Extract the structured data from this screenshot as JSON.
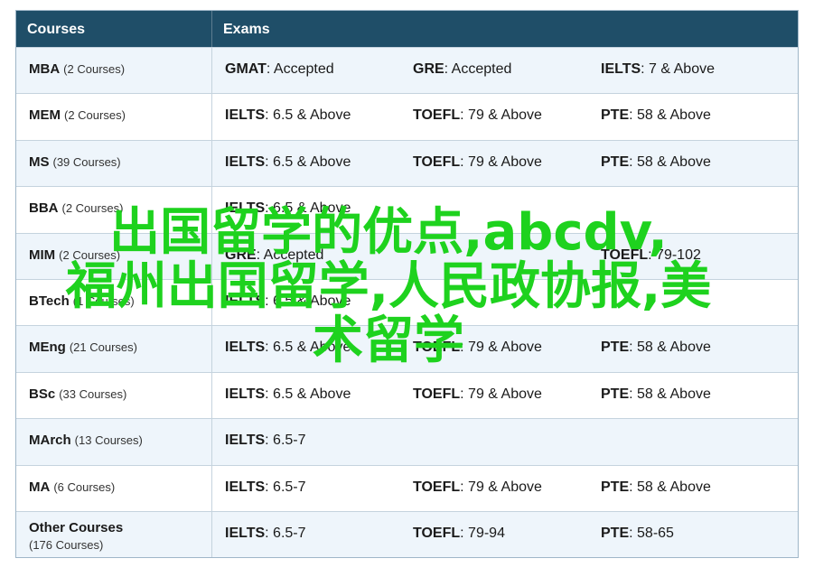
{
  "header": {
    "courses": "Courses",
    "exams": "Exams"
  },
  "rows": [
    {
      "name": "MBA",
      "count": "(2 Courses)",
      "exams": [
        {
          "k": "GMAT",
          "v": ": Accepted"
        },
        {
          "k": "GRE",
          "v": ": Accepted"
        },
        {
          "k": "IELTS",
          "v": ": 7 & Above"
        }
      ]
    },
    {
      "name": "MEM",
      "count": "(2 Courses)",
      "exams": [
        {
          "k": "IELTS",
          "v": ": 6.5 & Above"
        },
        {
          "k": "TOEFL",
          "v": ": 79 & Above"
        },
        {
          "k": "PTE",
          "v": ": 58 & Above"
        }
      ]
    },
    {
      "name": "MS",
      "count": "(39 Courses)",
      "exams": [
        {
          "k": "IELTS",
          "v": ": 6.5 & Above"
        },
        {
          "k": "TOEFL",
          "v": ": 79 & Above"
        },
        {
          "k": "PTE",
          "v": ": 58 & Above"
        }
      ]
    },
    {
      "name": "BBA",
      "count": "(2 Courses)",
      "exams": [
        {
          "k": "IELTS",
          "v": ": 6.5 & Above"
        },
        {
          "k": "",
          "v": ""
        },
        {
          "k": "",
          "v": ""
        }
      ]
    },
    {
      "name": "MIM",
      "count": "(2 Courses)",
      "exams": [
        {
          "k": "GRE",
          "v": ": Accepted"
        },
        {
          "k": "",
          "v": ""
        },
        {
          "k": "TOEFL",
          "v": ": 79-102"
        }
      ]
    },
    {
      "name": "BTech",
      "count": "(1 Courses)",
      "exams": [
        {
          "k": "IELTS",
          "v": ": 6.5 & Above"
        },
        {
          "k": "",
          "v": ""
        },
        {
          "k": "",
          "v": ""
        }
      ]
    },
    {
      "name": "MEng",
      "count": "(21 Courses)",
      "exams": [
        {
          "k": "IELTS",
          "v": ": 6.5 & Above"
        },
        {
          "k": "TOEFL",
          "v": ": 79 & Above"
        },
        {
          "k": "PTE",
          "v": ": 58 & Above"
        }
      ]
    },
    {
      "name": "BSc",
      "count": "(33 Courses)",
      "exams": [
        {
          "k": "IELTS",
          "v": ": 6.5 & Above"
        },
        {
          "k": "TOEFL",
          "v": ": 79 & Above"
        },
        {
          "k": "PTE",
          "v": ": 58 & Above"
        }
      ]
    },
    {
      "name": "MArch",
      "count": "(13 Courses)",
      "exams": [
        {
          "k": "IELTS",
          "v": ": 6.5-7"
        },
        {
          "k": "",
          "v": ""
        },
        {
          "k": "",
          "v": ""
        }
      ]
    },
    {
      "name": "MA",
      "count": "(6 Courses)",
      "exams": [
        {
          "k": "IELTS",
          "v": ": 6.5-7"
        },
        {
          "k": "TOEFL",
          "v": ": 79 & Above"
        },
        {
          "k": "PTE",
          "v": ": 58 & Above"
        }
      ]
    },
    {
      "name": "Other Courses",
      "count": "(176 Courses)",
      "exams": [
        {
          "k": "IELTS",
          "v": ": 6.5-7"
        },
        {
          "k": "TOEFL",
          "v": ": 79-94"
        },
        {
          "k": "PTE",
          "v": ": 58-65"
        }
      ]
    }
  ],
  "overlay": {
    "line1": "出国留学的优点,abcdv,",
    "line2": "福州出国留学,人民政协报,美",
    "line3": "术留学"
  },
  "colors": {
    "header_bg": "#1f4e68",
    "overlay_text": "#1ed21e"
  }
}
